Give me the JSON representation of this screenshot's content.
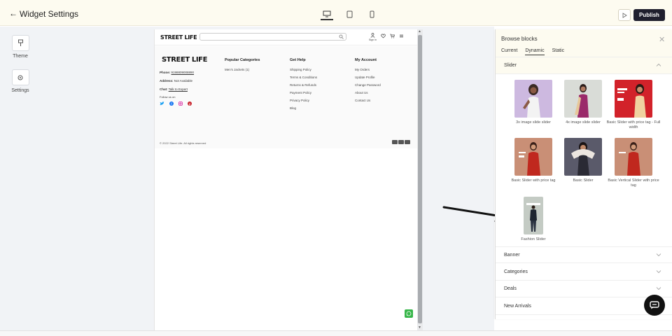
{
  "header": {
    "title": "Widget Settings",
    "publish_label": "Publish"
  },
  "left_rail": {
    "items": [
      {
        "label": "Theme",
        "icon": "paint-brush-icon"
      },
      {
        "label": "Settings",
        "icon": "gear-icon"
      }
    ]
  },
  "preview": {
    "logo": "STREET LIFE",
    "sign_in": "Sign In",
    "footer": {
      "logo": "STREET LIFE",
      "phone_label": "Phone:",
      "phone_value": "9198809008890",
      "address_label": "Address:",
      "address_value": "Not Available",
      "chat_label": "Chat:",
      "chat_value": "Talk to Expert",
      "follow": "Follow us on",
      "columns": [
        {
          "title": "Popular Categories",
          "items": [
            "Men's Jackets (1)"
          ]
        },
        {
          "title": "Get Help",
          "items": [
            "Shipping Policy",
            "Terms & Conditions",
            "Returns & Refunds",
            "Payment Policy",
            "Privacy Policy",
            "Blog"
          ]
        },
        {
          "title": "My Account",
          "items": [
            "My Orders",
            "Update Profile",
            "Change Password",
            "About Us",
            "Contact Us"
          ]
        }
      ],
      "copyright": "© 2022 Street Life. All rights reserved"
    }
  },
  "panel": {
    "title": "Browse blocks",
    "tabs": [
      "Current",
      "Dynamic",
      "Static"
    ],
    "active_tab": "Dynamic",
    "open_section": "Slider",
    "blocks": [
      {
        "label": "3x image slide slider"
      },
      {
        "label": "4x image slide slider"
      },
      {
        "label": "Basic Slider with price tag - Full width"
      },
      {
        "label": "Basic Slider with price tag"
      },
      {
        "label": "Basic Slider"
      },
      {
        "label": "Basic Vertical Slider with price tag"
      },
      {
        "label": "Fashion Slider"
      }
    ],
    "sections": [
      "Banner",
      "Categories",
      "Deals",
      "New Arrivals"
    ]
  },
  "colors": {
    "publish_bg": "#1f1f2e",
    "panel_head_bg": "#fdfbf0",
    "whatsapp": "#38b64a"
  }
}
